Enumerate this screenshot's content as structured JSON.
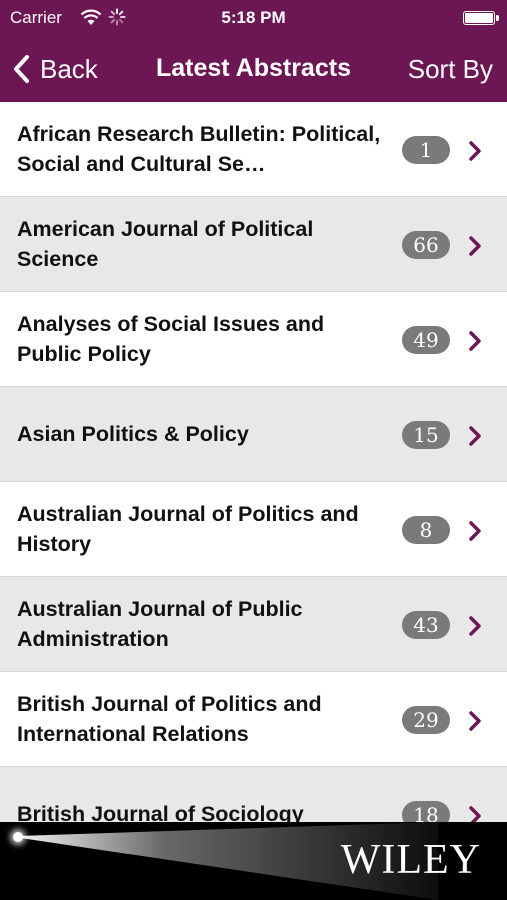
{
  "status_bar": {
    "carrier": "Carrier",
    "time": "5:18 PM"
  },
  "nav": {
    "back_label": "Back",
    "title": "Latest Abstracts",
    "sort_label": "Sort By"
  },
  "journals": [
    {
      "title": "African Research Bulletin: Political, Social and Cultural Se…",
      "count": "1"
    },
    {
      "title": "American Journal of Political Science",
      "count": "66"
    },
    {
      "title": "Analyses of Social Issues and Public Policy",
      "count": "49"
    },
    {
      "title": "Asian Politics & Policy",
      "count": "15"
    },
    {
      "title": "Australian Journal of Politics and History",
      "count": "8"
    },
    {
      "title": "Australian Journal of Public Administration",
      "count": "43"
    },
    {
      "title": "British Journal of Politics and International Relations",
      "count": "29"
    },
    {
      "title": "British Journal of Sociology",
      "count": "18"
    }
  ],
  "footer": {
    "brand": "WILEY"
  },
  "colors": {
    "brand": "#6d1654",
    "badge": "#7a7a7a",
    "row_alt": "#e8e8e8"
  },
  "icons": {
    "back": "chevron-left-icon",
    "row": "chevron-right-icon",
    "wifi": "wifi-icon",
    "activity": "activity-spinner-icon",
    "battery": "battery-icon"
  }
}
